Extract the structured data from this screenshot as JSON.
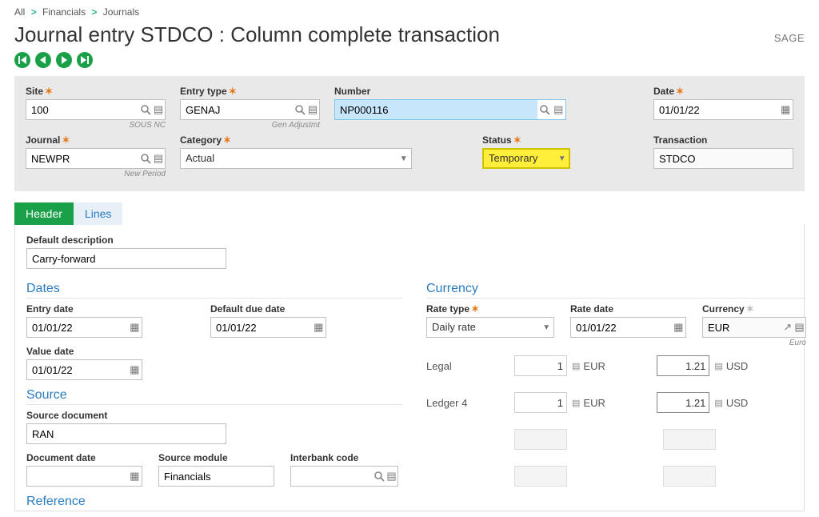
{
  "breadcrumb": {
    "all": "All",
    "financials": "Financials",
    "journals": "Journals"
  },
  "brand": "SAGE",
  "title": "Journal entry STDCO : Column complete transaction",
  "panel": {
    "site": {
      "label": "Site",
      "value": "100",
      "caption": "SOUS NC"
    },
    "entry_type": {
      "label": "Entry type",
      "value": "GENAJ",
      "caption": "Gen Adjustmt"
    },
    "number": {
      "label": "Number",
      "value": "NP000116"
    },
    "date": {
      "label": "Date",
      "value": "01/01/22"
    },
    "journal": {
      "label": "Journal",
      "value": "NEWPR",
      "caption": "New Period"
    },
    "category": {
      "label": "Category",
      "value": "Actual"
    },
    "status": {
      "label": "Status",
      "value": "Temporary"
    },
    "transaction": {
      "label": "Transaction",
      "value": "STDCO"
    }
  },
  "tabs": {
    "header": "Header",
    "lines": "Lines"
  },
  "form": {
    "default_desc": {
      "label": "Default description",
      "value": "Carry-forward"
    },
    "dates_title": "Dates",
    "entry_date": {
      "label": "Entry date",
      "value": "01/01/22"
    },
    "default_due": {
      "label": "Default due date",
      "value": "01/01/22"
    },
    "value_date": {
      "label": "Value date",
      "value": "01/01/22"
    },
    "source_title": "Source",
    "source_doc": {
      "label": "Source document",
      "value": "RAN"
    },
    "doc_date": {
      "label": "Document date",
      "value": ""
    },
    "src_module": {
      "label": "Source module",
      "value": "Financials"
    },
    "interbank": {
      "label": "Interbank code",
      "value": ""
    },
    "reference_title": "Reference",
    "currency_title": "Currency",
    "rate_type": {
      "label": "Rate type",
      "value": "Daily rate"
    },
    "rate_date": {
      "label": "Rate date",
      "value": "01/01/22"
    },
    "currency": {
      "label": "Currency",
      "value": "EUR",
      "caption": "Euro"
    },
    "legal": {
      "label": "Legal",
      "v1": "1",
      "u1": "EUR",
      "v2": "1.21",
      "u2": "USD"
    },
    "ledger4": {
      "label": "Ledger 4",
      "v1": "1",
      "u1": "EUR",
      "v2": "1.21",
      "u2": "USD"
    }
  }
}
